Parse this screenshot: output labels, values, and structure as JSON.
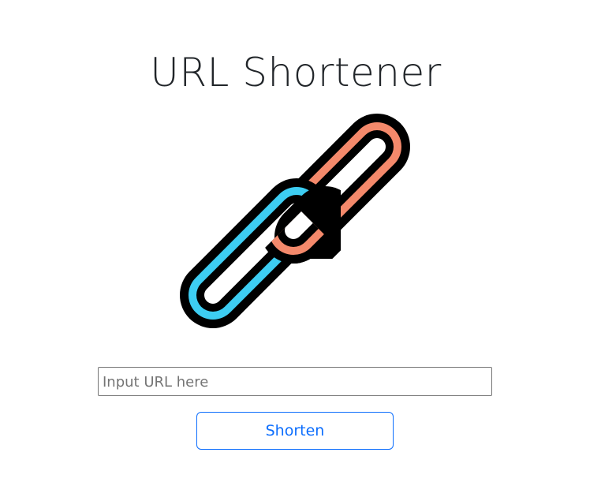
{
  "header": {
    "title": "URL Shortener"
  },
  "logo": {
    "icon": "chain-link-icon",
    "colors": {
      "top_link": "#f4896b",
      "bottom_link": "#3dcdf2",
      "outline": "#000000"
    }
  },
  "form": {
    "url_input": {
      "value": "",
      "placeholder": "Input URL here"
    },
    "submit_label": "Shorten"
  },
  "colors": {
    "accent": "#0d6efd",
    "text": "#212529"
  }
}
